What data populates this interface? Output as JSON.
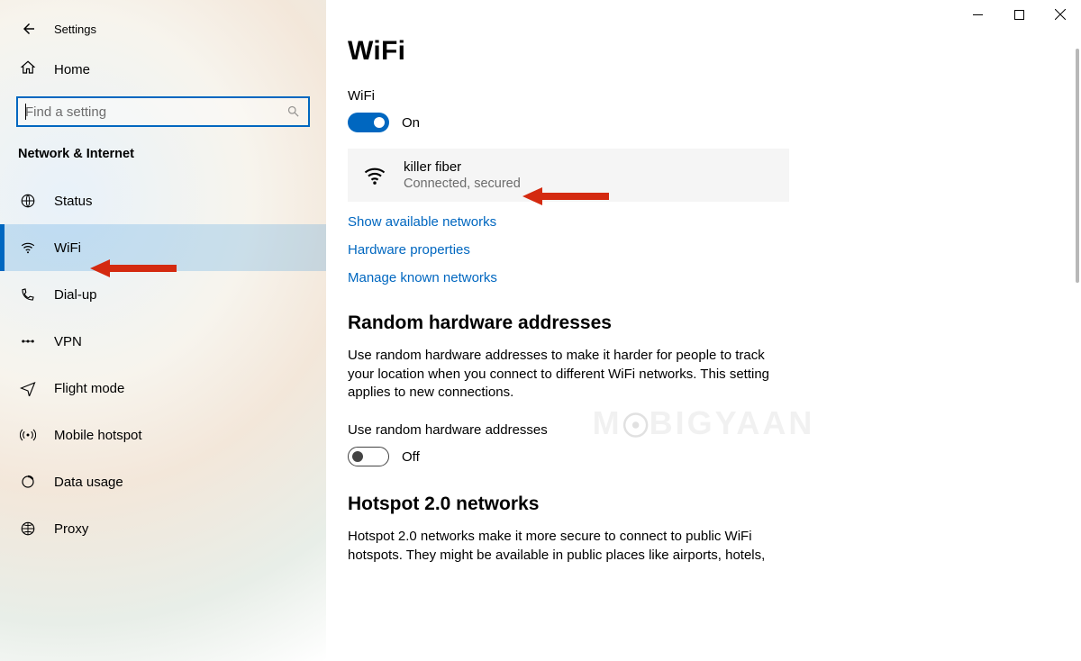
{
  "app": {
    "title": "Settings"
  },
  "sidebar": {
    "home_label": "Home",
    "search_placeholder": "Find a setting",
    "category": "Network & Internet",
    "items": [
      {
        "id": "status",
        "label": "Status"
      },
      {
        "id": "wifi",
        "label": "WiFi"
      },
      {
        "id": "dialup",
        "label": "Dial-up"
      },
      {
        "id": "vpn",
        "label": "VPN"
      },
      {
        "id": "flight",
        "label": "Flight mode"
      },
      {
        "id": "hotspot",
        "label": "Mobile hotspot"
      },
      {
        "id": "datausage",
        "label": "Data usage"
      },
      {
        "id": "proxy",
        "label": "Proxy"
      }
    ],
    "selected": "wifi"
  },
  "main": {
    "title": "WiFi",
    "wifi_toggle": {
      "label": "WiFi",
      "state_text": "On",
      "on": true
    },
    "current_network": {
      "ssid": "killer fiber",
      "status": "Connected, secured"
    },
    "links": {
      "available": "Show available networks",
      "hw_props": "Hardware properties",
      "known": "Manage known networks"
    },
    "random_hw": {
      "heading": "Random hardware addresses",
      "description": "Use random hardware addresses to make it harder for people to track your location when you connect to different WiFi networks. This setting applies to new connections.",
      "toggle_label": "Use random hardware addresses",
      "state_text": "Off",
      "on": false
    },
    "hotspot20": {
      "heading": "Hotspot 2.0 networks",
      "description": "Hotspot 2.0 networks make it more secure to connect to public WiFi hotspots. They might be available in public places like airports, hotels,"
    }
  },
  "watermark": "MOBIGYAAN",
  "colors": {
    "accent": "#0067c0",
    "arrow": "#d42a10"
  }
}
